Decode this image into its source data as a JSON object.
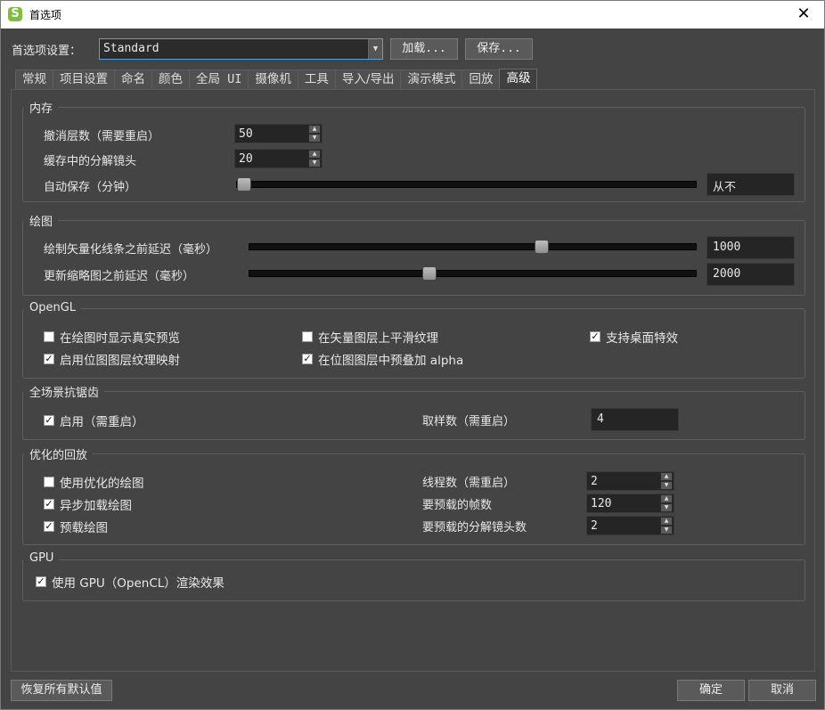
{
  "window": {
    "title": "首选项",
    "app_icon": "S"
  },
  "preset": {
    "label": "首选项设置：",
    "value": "Standard",
    "load_label": "加载...",
    "save_label": "保存..."
  },
  "tabs": [
    {
      "label": "常规"
    },
    {
      "label": "项目设置"
    },
    {
      "label": "命名"
    },
    {
      "label": "颜色"
    },
    {
      "label": "全局 UI"
    },
    {
      "label": "摄像机"
    },
    {
      "label": "工具"
    },
    {
      "label": "导入/导出"
    },
    {
      "label": "演示模式"
    },
    {
      "label": "回放"
    },
    {
      "label": "高级",
      "active": true
    }
  ],
  "memory": {
    "title": "内存",
    "undo_label": "撤消层数（需要重启）",
    "undo_value": "50",
    "cache_label": "缓存中的分解镜头",
    "cache_value": "20",
    "autosave_label": "自动保存（分钟）",
    "autosave_value": "从不",
    "autosave_level": 0
  },
  "drawing": {
    "title": "绘图",
    "vector_label": "绘制矢量化线条之前延迟（毫秒）",
    "vector_value": "1000",
    "vector_level": 0.66,
    "thumb_label": "更新缩略图之前延迟（毫秒）",
    "thumb_value": "2000",
    "thumb_level": 0.4
  },
  "opengl": {
    "title": "OpenGL",
    "realistic_preview": {
      "label": "在绘图时显示真实预览",
      "checked": false
    },
    "smooth_texture": {
      "label": "在矢量图层上平滑纹理",
      "checked": false
    },
    "desktop_effects": {
      "label": "支持桌面特效",
      "checked": true
    },
    "bitmap_mipmap": {
      "label": "启用位图图层纹理映射",
      "checked": true
    },
    "premultiply_alpha": {
      "label": "在位图图层中预叠加 alpha",
      "checked": true
    }
  },
  "antialias": {
    "title": "全场景抗锯齿",
    "enable": {
      "label": "启用（需重启）",
      "checked": true
    },
    "samples_label": "取样数（需重启）",
    "samples_value": "4"
  },
  "playback": {
    "title": "优化的回放",
    "optimized": {
      "label": "使用优化的绘图",
      "checked": false
    },
    "async_load": {
      "label": "异步加载绘图",
      "checked": true
    },
    "preload": {
      "label": "预载绘图",
      "checked": true
    },
    "threads_label": "线程数（需重启）",
    "threads_value": "2",
    "frames_label": "要预载的帧数",
    "frames_value": "120",
    "breakdown_label": "要预载的分解镜头数",
    "breakdown_value": "2"
  },
  "gpu": {
    "title": "GPU",
    "use_gpu": {
      "label": "使用 GPU（OpenCL）渲染效果",
      "checked": true
    }
  },
  "footer": {
    "restore_label": "恢复所有默认值",
    "ok_label": "确定",
    "cancel_label": "取消"
  },
  "icons": {
    "close": "close-icon",
    "dropdown": "chevron-down-icon",
    "check": "checkmark-icon"
  }
}
